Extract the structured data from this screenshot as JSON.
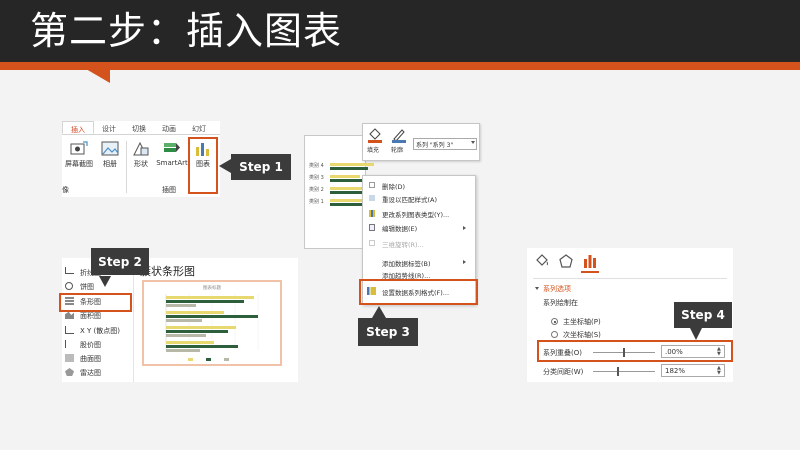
{
  "slide": {
    "title": "第二步：插入图表"
  },
  "steps": {
    "step1": "Step 1",
    "step2": "Step 2",
    "step3": "Step 3",
    "step4": "Step 4"
  },
  "ribbon": {
    "tabs": [
      "插入",
      "设计",
      "切换",
      "动画",
      "幻灯"
    ],
    "screenshot_label": "屏幕截图",
    "album_label": "相册",
    "shape_label": "形状",
    "smartart_label": "SmartArt",
    "chart_label": "图表",
    "group_image": "像",
    "group_illustrations": "插图"
  },
  "chart_dialog": {
    "sidebar": [
      "折线图",
      "饼图",
      "条形图",
      "面积图",
      "X Y (散点图)",
      "股价图",
      "曲面图",
      "雷达图"
    ],
    "heading": "簇状条形图",
    "preview_title": "图表标题"
  },
  "context_menu": {
    "fill_label": "填充",
    "outline_label": "轮廓",
    "series_value": "系列 \"系列 3\"",
    "chart_categories": [
      "类别 4",
      "类别 3",
      "类别 2",
      "类别 1"
    ],
    "items": [
      "删除(D)",
      "重设以匹配样式(A)",
      "更改系列图表类型(Y)...",
      "编辑数据(E)",
      "三维旋转(R)...",
      "添加数据标签(B)",
      "添加趋势线(R)...",
      "设置数据系列格式(F)..."
    ]
  },
  "format_pane": {
    "section_title": "系列选项",
    "plot_on_label": "系列绘制在",
    "primary_axis": "主坐标轴(P)",
    "secondary_axis": "次坐标轴(S)",
    "overlap_label": "系列重叠(O)",
    "overlap_value": ".00%",
    "gap_label": "分类间距(W)",
    "gap_value": "182%"
  },
  "colors": {
    "accent": "#d4521c",
    "title_bg": "#262626",
    "callout_bg": "#3b3b3b",
    "bar_yellow": "#e8d870",
    "bar_green": "#2d5f3c",
    "bar_gray": "#b8b8a8"
  }
}
